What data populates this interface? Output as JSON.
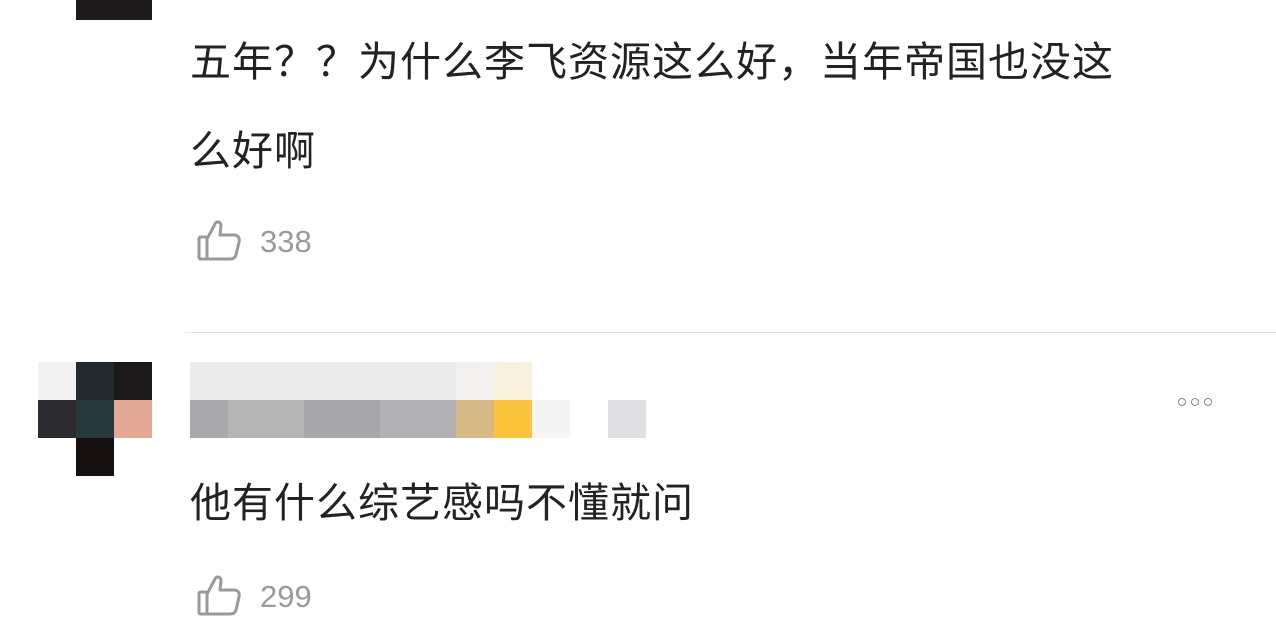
{
  "comments": [
    {
      "text_line1": "五年？？为什么李飞资源这么好，当年帝国也没这",
      "text_line2": "么好啊",
      "likes": "338"
    },
    {
      "text": "他有什么综艺感吗不懂就问",
      "likes": "299"
    }
  ],
  "icons": {
    "like": "thumbs-up-icon",
    "more": "more-dots-icon"
  },
  "colors": {
    "text": "#222222",
    "count": "#9a9a9a",
    "divider": "#e4e4e4"
  }
}
